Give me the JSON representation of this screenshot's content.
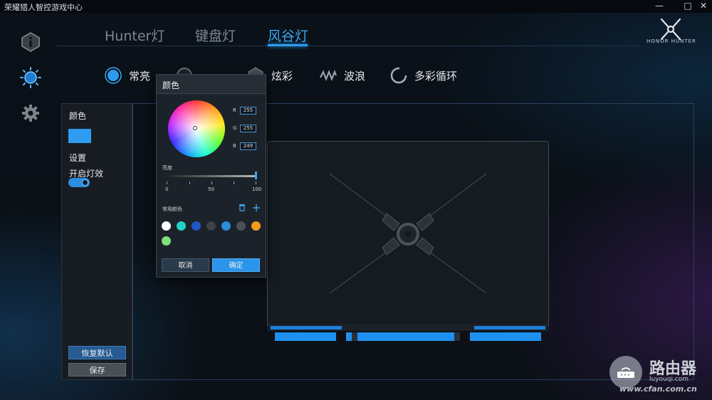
{
  "app": {
    "title": "荣耀猎人智控游戏中心"
  },
  "window_controls": {
    "minimize": "—",
    "maximize": "□",
    "close": "✕"
  },
  "sidebar": {
    "items": [
      {
        "icon": "info-icon"
      },
      {
        "icon": "lighting-icon",
        "active": true
      },
      {
        "icon": "gear-icon"
      }
    ]
  },
  "tabs": [
    {
      "label": "Hunter灯",
      "active": false
    },
    {
      "label": "键盘灯",
      "active": false
    },
    {
      "label": "风谷灯",
      "active": true
    }
  ],
  "brand": {
    "name": "HONOR HUNTER"
  },
  "modes": [
    {
      "label": "常亮",
      "icon": "steady-glow-icon",
      "active": true
    },
    {
      "label": "",
      "icon": "breathing-icon",
      "active": false
    },
    {
      "label": "炫彩",
      "icon": "dazzle-icon",
      "active": false
    },
    {
      "label": "波浪",
      "icon": "wave-icon",
      "active": false
    },
    {
      "label": "多彩循环",
      "icon": "cycle-icon",
      "active": false
    }
  ],
  "settings": {
    "color_label": "颜色",
    "color_value": "#2e9cf0",
    "section_label": "设置",
    "effect_toggle_label": "开启灯效",
    "effect_enabled": true,
    "reset_label": "恢复默认",
    "save_label": "保存"
  },
  "color_picker": {
    "title": "颜色",
    "r_label": "R",
    "r_value": "255",
    "g_label": "G",
    "g_value": "255",
    "b_label": "B",
    "b_value": "249",
    "brightness_label": "亮度",
    "brightness_ticks": [
      "0",
      "50",
      "100"
    ],
    "brightness_value": 100,
    "common_colors_label": "常用颜色",
    "common_colors": [
      "#ffffff",
      "#22d3c5",
      "#1f57c9",
      "#3c4348",
      "#2a8fd9",
      "#4a5056",
      "#f29a1e",
      "#7fe07a"
    ],
    "cancel_label": "取消",
    "ok_label": "确定"
  },
  "watermark": {
    "name": "路由器",
    "sub": "luyouqi.com",
    "url": "www.cfan.com.cn"
  }
}
